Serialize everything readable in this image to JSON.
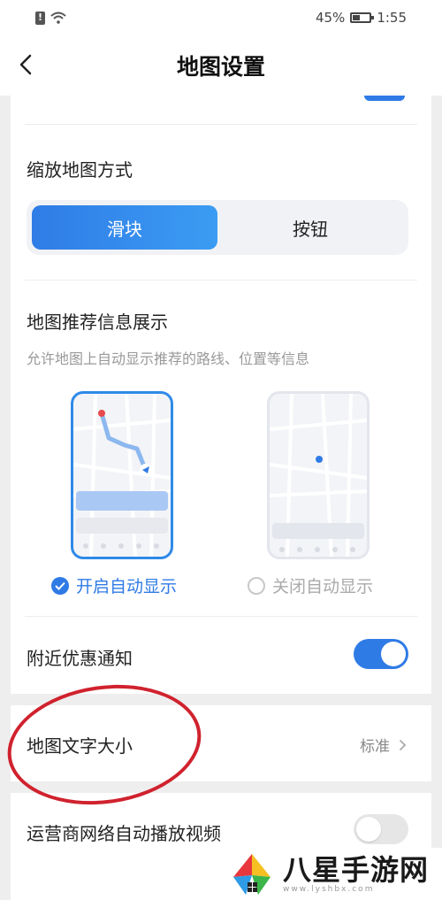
{
  "status_bar": {
    "battery": "45%",
    "time": "1:55"
  },
  "nav": {
    "title": "地图设置"
  },
  "zoom_mode": {
    "title": "缩放地图方式",
    "options": [
      "滑块",
      "按钮"
    ],
    "selected": "滑块"
  },
  "recommend": {
    "title": "地图推荐信息展示",
    "description": "允许地图上自动显示推荐的路线、位置等信息",
    "option_on": "开启自动显示",
    "option_off": "关闭自动显示",
    "selected": "开启自动显示"
  },
  "nearby_deals": {
    "label": "附近优惠通知",
    "enabled": true
  },
  "font_size": {
    "label": "地图文字大小",
    "value": "标准"
  },
  "carrier_video": {
    "label": "运营商网络自动播放视频",
    "enabled": false
  },
  "watermark": {
    "text": "八星手游网",
    "url": "www.lyshbx.com"
  },
  "colors": {
    "accent": "#2f7be6",
    "annotation": "#d0222e"
  }
}
